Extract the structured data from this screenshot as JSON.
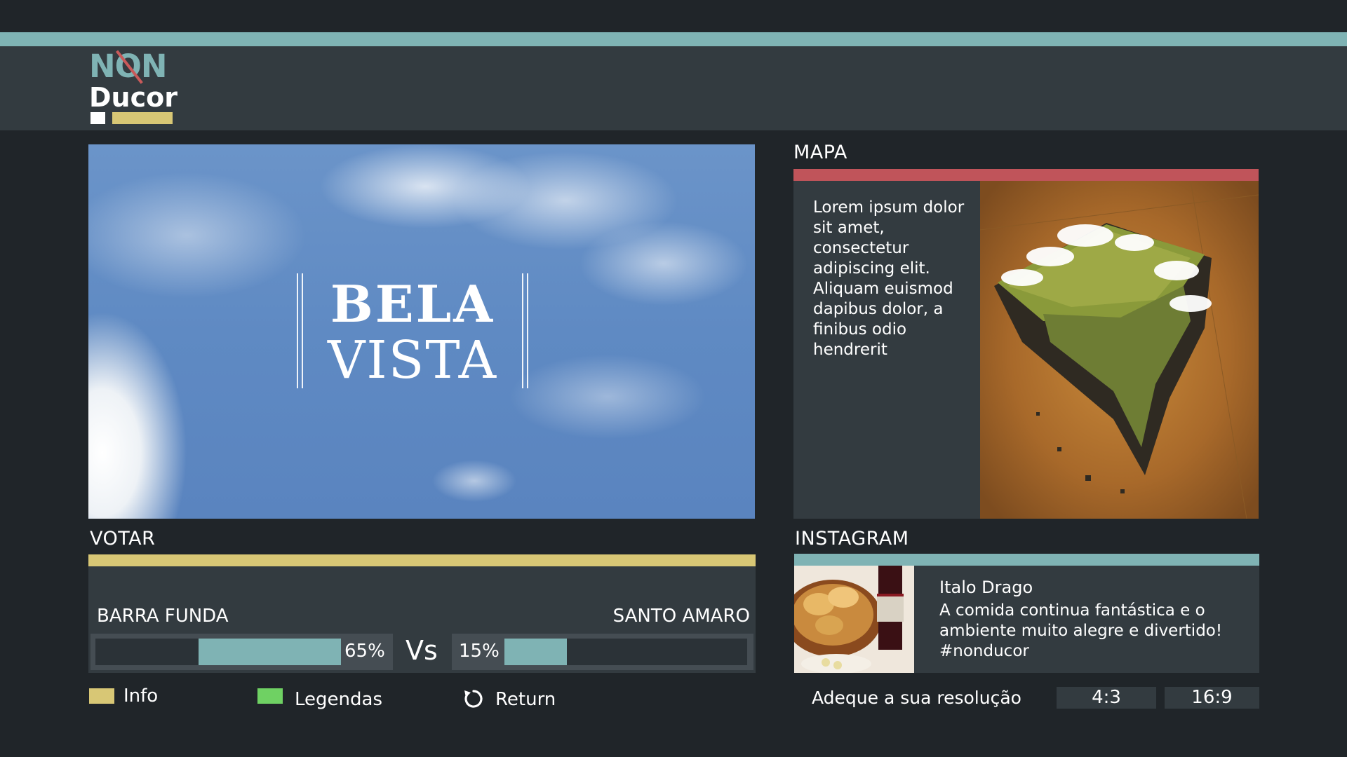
{
  "brand": {
    "logo_line1": "NON",
    "logo_line2": "Ducor",
    "accent_teal": "#7fb3b4",
    "accent_yellow": "#d8c775",
    "accent_red": "#c0545a",
    "accent_green": "#6fd163"
  },
  "hero": {
    "title_line1": "BELA",
    "title_line2": "VISTA"
  },
  "map": {
    "title": "MAPA",
    "text": "Lorem ipsum dolor sit amet, consectetur adipiscing elit. Aliquam euismod dapibus dolor, a finibus odio hendrerit"
  },
  "vote": {
    "title": "VOTAR",
    "left_team": "BARRA FUNDA",
    "left_percent_label": "65%",
    "left_value": 65,
    "vs_label": "Vs",
    "right_team": "SANTO AMARO",
    "right_percent_label": "15%",
    "right_value": 15
  },
  "instagram": {
    "title": "INSTAGRAM",
    "user": "Italo Drago",
    "caption": "A comida continua fantástica e o ambiente muito alegre e divertido! #nonducor"
  },
  "controls": {
    "info_label": "Info",
    "legendas_label": "Legendas",
    "return_label": "Return",
    "resolution_label": "Adeque a sua resolução",
    "res_option_1": "4:3",
    "res_option_2": "16:9"
  }
}
